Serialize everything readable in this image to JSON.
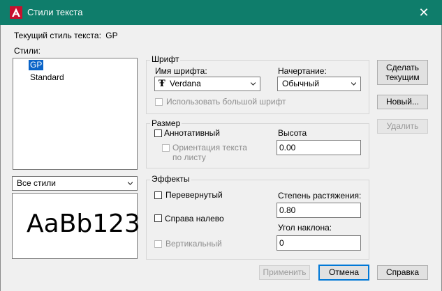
{
  "window": {
    "title": "Стили текста",
    "close_glyph": "✕",
    "icon": "autocad-a-icon",
    "accent_color": "#0f7d6b"
  },
  "current_style": {
    "label": "Текущий стиль текста:",
    "value": "GP"
  },
  "styles": {
    "label": "Стили:",
    "items": [
      "GP",
      "Standard"
    ],
    "selected": "GP",
    "filter_value": "Все стили"
  },
  "preview": {
    "text": "AaBb123"
  },
  "font_group": {
    "title": "Шрифт",
    "font_name_label": "Имя шрифта:",
    "font_name_value": "Verdana",
    "font_icon": "truetype-icon",
    "style_label": "Начертание:",
    "style_value": "Обычный",
    "big_font_label": "Использовать большой шрифт"
  },
  "size_group": {
    "title": "Размер",
    "annotative_label": "Аннотативный",
    "orientation_label_line1": "Ориентация текста",
    "orientation_label_line2": "по листу",
    "height_label": "Высота",
    "height_value": "0.00"
  },
  "effects_group": {
    "title": "Эффекты",
    "upside_down_label": "Перевернутый",
    "backwards_label": "Справа налево",
    "vertical_label": "Вертикальный",
    "width_factor_label": "Степень растяжения:",
    "width_factor_value": "0.80",
    "oblique_label": "Угол наклона:",
    "oblique_value": "0"
  },
  "side_buttons": {
    "set_current_line1": "Сделать",
    "set_current_line2": "текущим",
    "new": "Новый...",
    "delete": "Удалить"
  },
  "bottom_buttons": {
    "apply": "Применить",
    "cancel": "Отмена",
    "help": "Справка"
  }
}
